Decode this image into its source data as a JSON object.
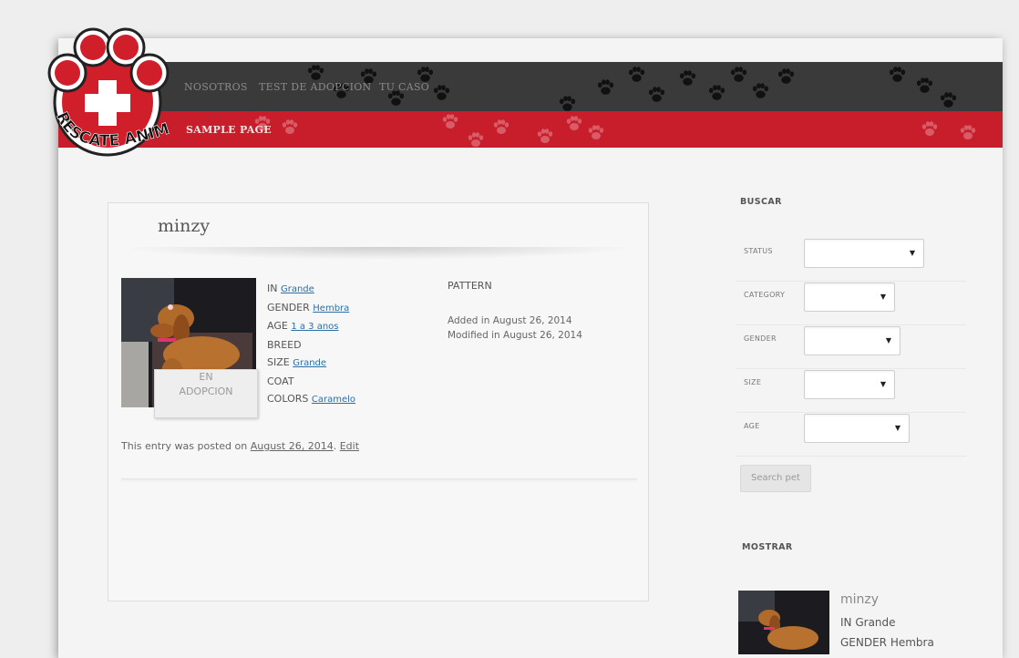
{
  "nav": {
    "top_items": [
      "NOSOTROS",
      "TEST DE ADOPCION",
      "TU CASO"
    ],
    "sub_items": [
      "SAMPLE PAGE"
    ]
  },
  "logo": {
    "text": "RESCATE ANIMAL",
    "icon": "paw-cross-icon"
  },
  "post": {
    "title": "minzy",
    "status_badge": [
      "EN",
      "ADOPCION"
    ],
    "details": [
      {
        "label": "IN",
        "value": "Grande"
      },
      {
        "label": "GENDER",
        "value": "Hembra"
      },
      {
        "label": "AGE",
        "value": "1 a 3 anos"
      },
      {
        "label": "BREED",
        "value": ""
      },
      {
        "label": "SIZE",
        "value": "Grande"
      },
      {
        "label": "COAT",
        "value": ""
      },
      {
        "label": "COLORS",
        "value": "Caramelo"
      }
    ],
    "pattern_label": "PATTERN",
    "added": "Added in August 26, 2014",
    "modified": "Modified in August 26, 2014",
    "posted_prefix": "This entry was posted on",
    "posted_date": "August 26, 2014",
    "edit_label": "Edit"
  },
  "sidebar": {
    "search_heading": "BUSCAR",
    "filters": [
      {
        "label": "STATUS",
        "value": ""
      },
      {
        "label": "CATEGORY",
        "value": ""
      },
      {
        "label": "GENDER",
        "value": ""
      },
      {
        "label": "SIZE",
        "value": ""
      },
      {
        "label": "AGE",
        "value": ""
      }
    ],
    "search_button": "Search pet",
    "show_heading": "MOSTRAR",
    "listing": {
      "name": "minzy",
      "in": "IN Grande",
      "gender": "GENDER Hembra"
    }
  },
  "colors": {
    "brand_red": "#c81e2c",
    "nav_dark": "#3a3a3a",
    "link": "#2a6fa8"
  }
}
